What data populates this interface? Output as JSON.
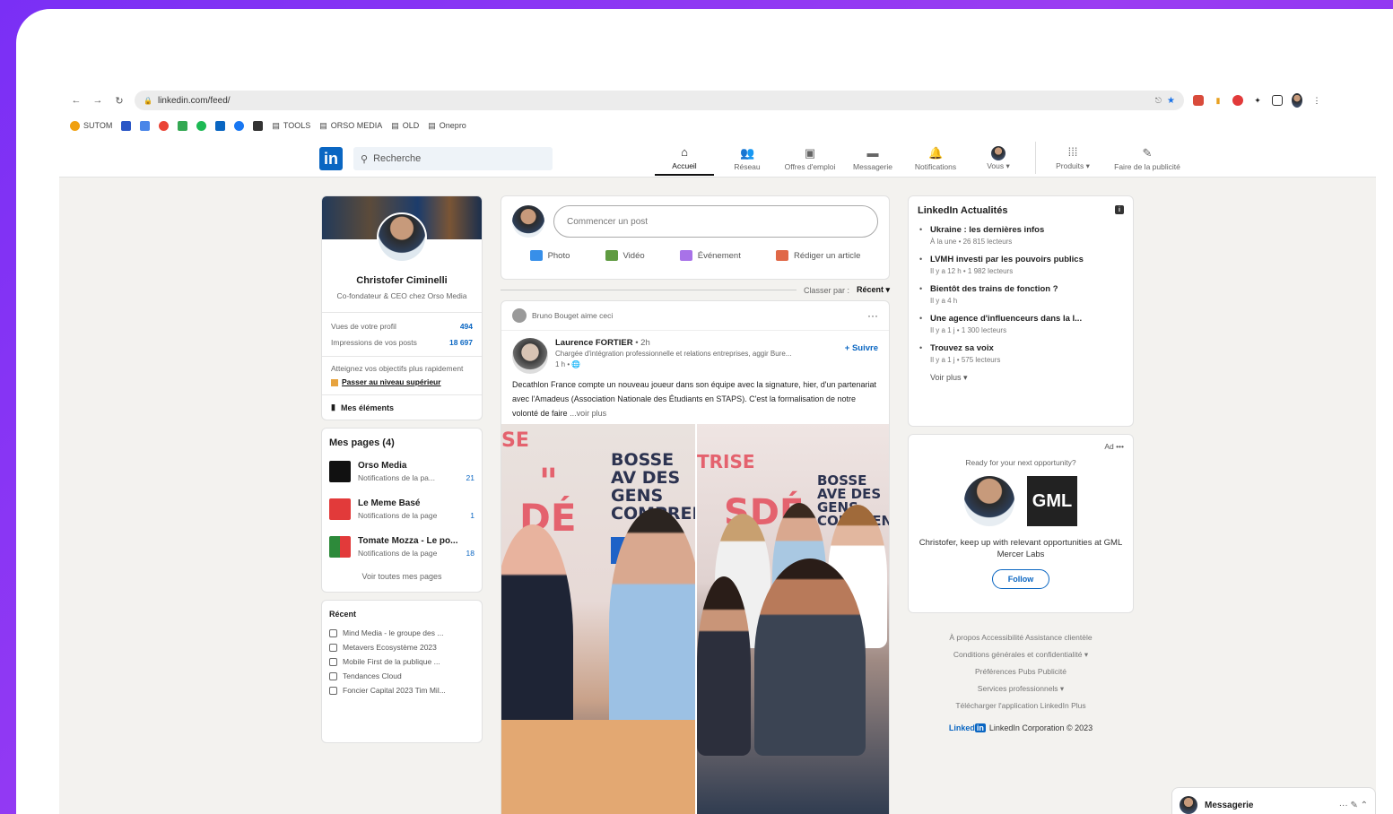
{
  "browser": {
    "url": "linkedin.com/feed/",
    "bookmarks": [
      "SUTOM",
      "TOOLS",
      "ORSO MEDIA",
      "OLD",
      "Onepro"
    ]
  },
  "topbar": {
    "search_placeholder": "Recherche",
    "nav": [
      {
        "label": "Accueil",
        "icon": "home-icon",
        "active": true
      },
      {
        "label": "Réseau",
        "icon": "network-icon"
      },
      {
        "label": "Offres d'emploi",
        "icon": "briefcase-icon"
      },
      {
        "label": "Messagerie",
        "icon": "chat-icon"
      },
      {
        "label": "Notifications",
        "icon": "bell-icon"
      },
      {
        "label": "Vous ▾",
        "icon": "avatar-icon"
      },
      {
        "label": "Produits ▾",
        "icon": "grid-icon"
      },
      {
        "label": "Faire de la publicité",
        "icon": "ad-icon"
      }
    ]
  },
  "profile": {
    "name": "Christofer Ciminelli",
    "title": "Co-fondateur & CEO chez Orso Media",
    "stats": [
      {
        "label": "Vues de votre profil",
        "value": "494"
      },
      {
        "label": "Impressions de vos posts",
        "value": "18 697"
      }
    ],
    "premium_text": "Atteignez vos objectifs plus rapidement",
    "premium_cta": "Passer au niveau supérieur",
    "saved": "Mes éléments"
  },
  "pages": {
    "title": "Mes pages (4)",
    "items": [
      {
        "name": "Orso Media",
        "sub": "Notifications de la pa...",
        "count": "21",
        "color": "#111111"
      },
      {
        "name": "Le Meme Basé",
        "sub": "Notifications de la page",
        "count": "1",
        "color": "#e23a3a"
      },
      {
        "name": "Tomate Mozza - Le po...",
        "sub": "Notifications de la page",
        "count": "18",
        "color": "#2d8a3a"
      }
    ],
    "see_all": "Voir toutes mes pages"
  },
  "recent": {
    "title": "Récent",
    "items": [
      "Mind Media - le groupe des ...",
      "Metavers Ecosystème 2023",
      "Mobile First de la publique ...",
      "Tendances Cloud",
      "Foncier Capital 2023 Tim Mil..."
    ]
  },
  "composer": {
    "placeholder": "Commencer un post",
    "actions": [
      {
        "label": "Photo",
        "color": "#378fe9"
      },
      {
        "label": "Vidéo",
        "color": "#5f9b41"
      },
      {
        "label": "Événement",
        "color": "#c37d16"
      },
      {
        "label": "Rédiger un article",
        "color": "#e06847"
      }
    ]
  },
  "sort": {
    "label": "Classer par :",
    "value": "Récent ▾"
  },
  "post": {
    "liked_by": "Bruno Bouget aime ceci",
    "author": "Laurence FORTIER",
    "time": "• 2h",
    "author_sub": "Chargée d'intégration professionnelle et relations entreprises, aggir Bure...",
    "author_sub2": "1 h • 🌐",
    "follow": "+ Suivre",
    "text": "Decathlon France compte un nouveau joueur dans son équipe avec la signature, hier, d'un partenariat avec l'Amadeus (Association Nationale des Étudiants en STAPS). C'est la formalisation de notre volonté de faire",
    "more": "...voir plus",
    "img_left_text": "BOSSE AV DES GENS COMPREI",
    "img_right_text": "BOSSE AVE DES GENS COMPREN",
    "img_pink_left": "SE",
    "img_pink_right": "TRISE"
  },
  "news": {
    "title": "LinkedIn Actualités",
    "items": [
      {
        "title": "Ukraine : les dernières infos",
        "sub": "À la une • 26 815 lecteurs"
      },
      {
        "title": "LVMH investi par les pouvoirs publics",
        "sub": "Il y a 12 h • 1 982 lecteurs"
      },
      {
        "title": "Bientôt des trains de fonction ?",
        "sub": "Il y a 4 h"
      },
      {
        "title": "Une agence d'influenceurs dans la l...",
        "sub": "Il y a 1 j • 1 300 lecteurs"
      },
      {
        "title": "Trouvez sa voix",
        "sub": "Il y a 1 j • 575 lecteurs"
      }
    ],
    "see_more": "Voir plus ▾"
  },
  "ad": {
    "top": "Ad •••",
    "question": "Ready for your next opportunity?",
    "logo_text": "GML",
    "text": "Christofer, keep up with relevant opportunities at GML Mercer Labs",
    "button": "Follow"
  },
  "footer": {
    "lines": [
      "À propos   Accessibilité   Assistance clientèle",
      "Conditions générales et confidentialité ▾",
      "Préférences Pubs   Publicité",
      "Services professionnels ▾",
      "Télécharger l'application LinkedIn   Plus"
    ],
    "brand": "LinkedIn Corporation © 2023"
  },
  "messaging": {
    "label": "Messagerie",
    "acts": "···  ✎  ⌃"
  }
}
